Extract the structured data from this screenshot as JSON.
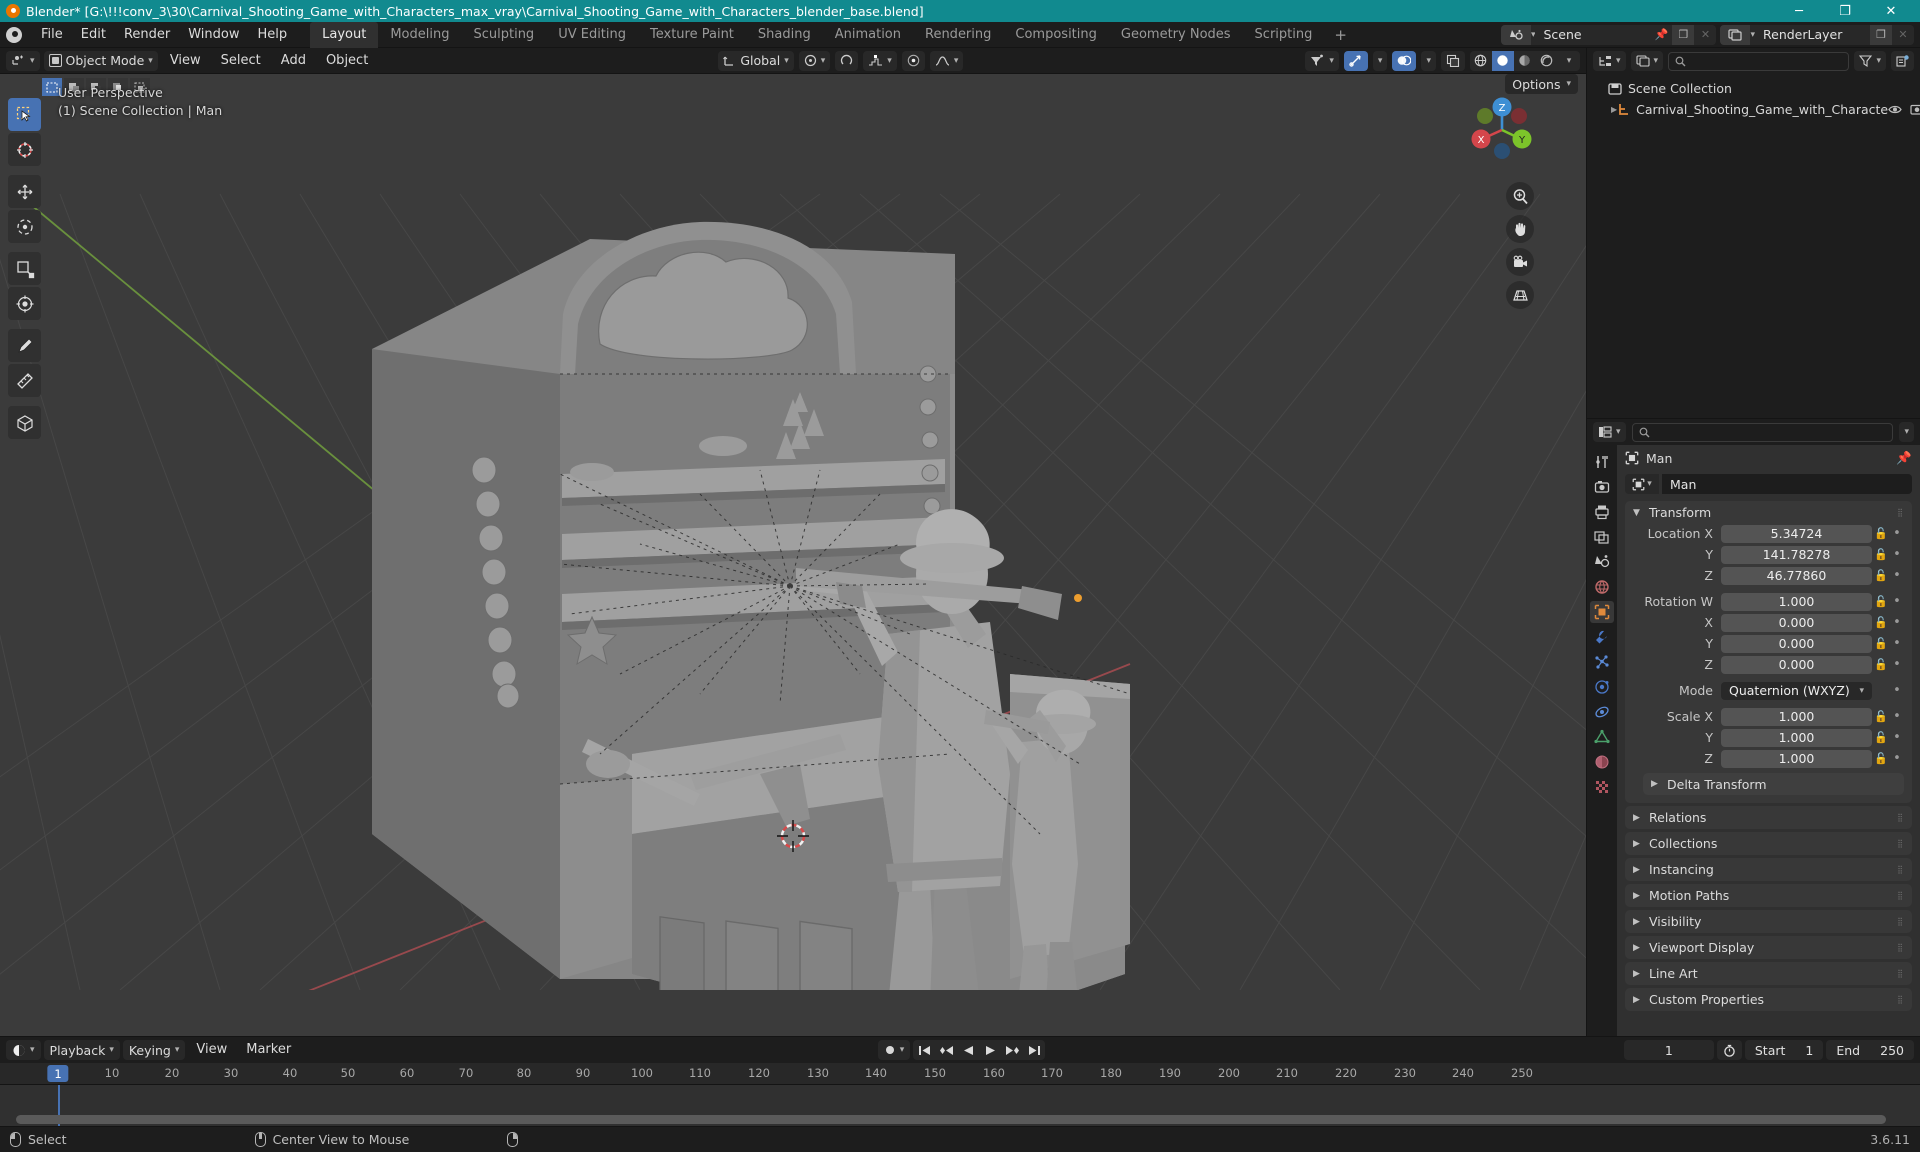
{
  "window": {
    "title": "Blender* [G:\\!!!conv_3\\30\\Carnival_Shooting_Game_with_Characters_max_vray\\Carnival_Shooting_Game_with_Characters_blender_base.blend]",
    "minimize": "─",
    "maximize": "❐",
    "close": "✕",
    "accent": "#118a8f"
  },
  "topbar": {
    "menus": [
      "File",
      "Edit",
      "Render",
      "Window",
      "Help"
    ],
    "workspaces": [
      {
        "label": "Layout",
        "active": true
      },
      {
        "label": "Modeling",
        "active": false
      },
      {
        "label": "Sculpting",
        "active": false
      },
      {
        "label": "UV Editing",
        "active": false
      },
      {
        "label": "Texture Paint",
        "active": false
      },
      {
        "label": "Shading",
        "active": false
      },
      {
        "label": "Animation",
        "active": false
      },
      {
        "label": "Rendering",
        "active": false
      },
      {
        "label": "Compositing",
        "active": false
      },
      {
        "label": "Geometry Nodes",
        "active": false
      },
      {
        "label": "Scripting",
        "active": false
      }
    ],
    "add_workspace": "+",
    "scene_name": "Scene",
    "view_layer_name": "RenderLayer"
  },
  "viewport": {
    "mode": "Object Mode",
    "menus": [
      "View",
      "Select",
      "Add",
      "Object"
    ],
    "transform_orientation": "Global",
    "overlay_line1": "User Perspective",
    "overlay_line2": "(1) Scene Collection | Man",
    "options_label": "Options",
    "gizmo_axes": {
      "x": "X",
      "y": "Y",
      "z": "Z"
    },
    "tools": [
      "tweak-select-tool",
      "cursor-tool",
      "move-tool",
      "rotate-tool",
      "scale-tool",
      "transform-tool",
      "annotate-tool",
      "measure-tool",
      "add-cube-tool"
    ],
    "bg_color": "#3b3b3b",
    "grid_color": "#4a4a4a",
    "x_axis_color": "#9e4f52",
    "y_axis_color": "#6a8a3a"
  },
  "outliner": {
    "search_placeholder": "",
    "rows": [
      {
        "label": "Scene Collection",
        "indent": 0,
        "icon": "collection-icon",
        "has_disclosure": false
      },
      {
        "label": "Carnival_Shooting_Game_with_Characte",
        "indent": 1,
        "icon": "armature-icon",
        "has_disclosure": true
      }
    ]
  },
  "properties": {
    "search_placeholder": "",
    "breadcrumb_object": "Man",
    "id_name": "Man",
    "tabs": [
      "tool-icon",
      "render-icon",
      "output-icon",
      "view-layer-icon",
      "scene-icon",
      "world-icon",
      "object-icon",
      "modifier-icon",
      "particles-icon",
      "physics-icon",
      "constraints-icon",
      "data-icon",
      "material-icon",
      "texture-icon"
    ],
    "active_tab_index": 6,
    "transform": {
      "title": "Transform",
      "rows": [
        {
          "label": "Location X",
          "value": "5.34724"
        },
        {
          "label": "Y",
          "value": "141.78278"
        },
        {
          "label": "Z",
          "value": "46.77860"
        },
        {
          "label": "Rotation W",
          "value": "1.000"
        },
        {
          "label": "X",
          "value": "0.000"
        },
        {
          "label": "Y",
          "value": "0.000"
        },
        {
          "label": "Z",
          "value": "0.000"
        }
      ],
      "mode_label": "Mode",
      "mode_value": "Quaternion (WXYZ)",
      "scale_rows": [
        {
          "label": "Scale X",
          "value": "1.000"
        },
        {
          "label": "Y",
          "value": "1.000"
        },
        {
          "label": "Z",
          "value": "1.000"
        }
      ],
      "delta_transform": "Delta Transform"
    },
    "panels": [
      "Relations",
      "Collections",
      "Instancing",
      "Motion Paths",
      "Visibility",
      "Viewport Display",
      "Line Art",
      "Custom Properties"
    ]
  },
  "timeline": {
    "playback": "Playback",
    "keying": "Keying",
    "view": "View",
    "marker": "Marker",
    "current_frame": "1",
    "start_label": "Start",
    "start_value": "1",
    "end_label": "End",
    "end_value": "250",
    "playhead_frame": "1",
    "ticks": [
      10,
      20,
      30,
      40,
      50,
      60,
      70,
      80,
      90,
      100,
      110,
      120,
      130,
      140,
      150,
      160,
      170,
      180,
      190,
      200,
      210,
      220,
      230,
      240,
      250
    ],
    "transport_icons": [
      "jump-start",
      "prev-keyframe",
      "play-reverse",
      "play",
      "next-keyframe",
      "jump-end"
    ]
  },
  "statusbar": {
    "items": [
      {
        "mouse": "left",
        "label": "Select"
      },
      {
        "mouse": "middle",
        "label": "Center View to Mouse"
      },
      {
        "mouse": "right",
        "label": ""
      }
    ],
    "version": "3.6.11"
  }
}
